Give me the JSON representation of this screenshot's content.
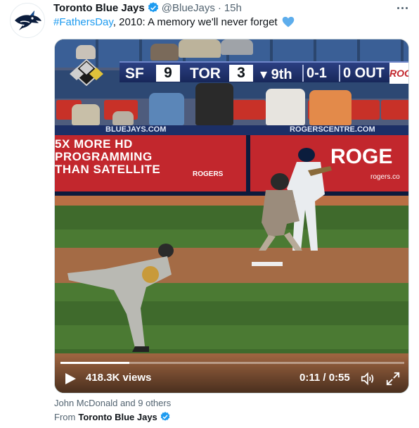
{
  "tweet": {
    "author_name": "Toronto Blue Jays",
    "handle": "@BlueJays",
    "separator": "·",
    "time": "15h",
    "hashtag": "#FathersDay",
    "text_rest": ", 2010: A memory we'll never forget",
    "more_icon": "more-horizontal-icon"
  },
  "video": {
    "scoreboard": {
      "away_team": "SF",
      "away_score": "9",
      "home_team": "TOR",
      "home_score": "3",
      "inning": "▾ 9th",
      "count": "0-1",
      "outs": "0 OUT",
      "network_logo": "ROG sp"
    },
    "stadium_signs": {
      "wall_left": "BLUEJAYS.COM",
      "wall_right": "ROGERSCENTRE.COM",
      "ad_line1": "5X MORE HD",
      "ad_line2": "PROGRAMMING",
      "ad_line3": "THAN SATELLITE",
      "ad_brand_small": "ROGERS",
      "ad_brand_big": "ROGE",
      "ad_url": "rogers.co"
    },
    "views": "418.3K views",
    "time_readout": "0:11 / 0:55",
    "progress_fraction": 0.2
  },
  "footer": {
    "tagged": "John McDonald and 9 others",
    "from_label": "From",
    "from_name": "Toronto Blue Jays"
  },
  "colors": {
    "link": "#1d9bf0",
    "verified": "#1d9bf0",
    "muted": "#536471"
  }
}
